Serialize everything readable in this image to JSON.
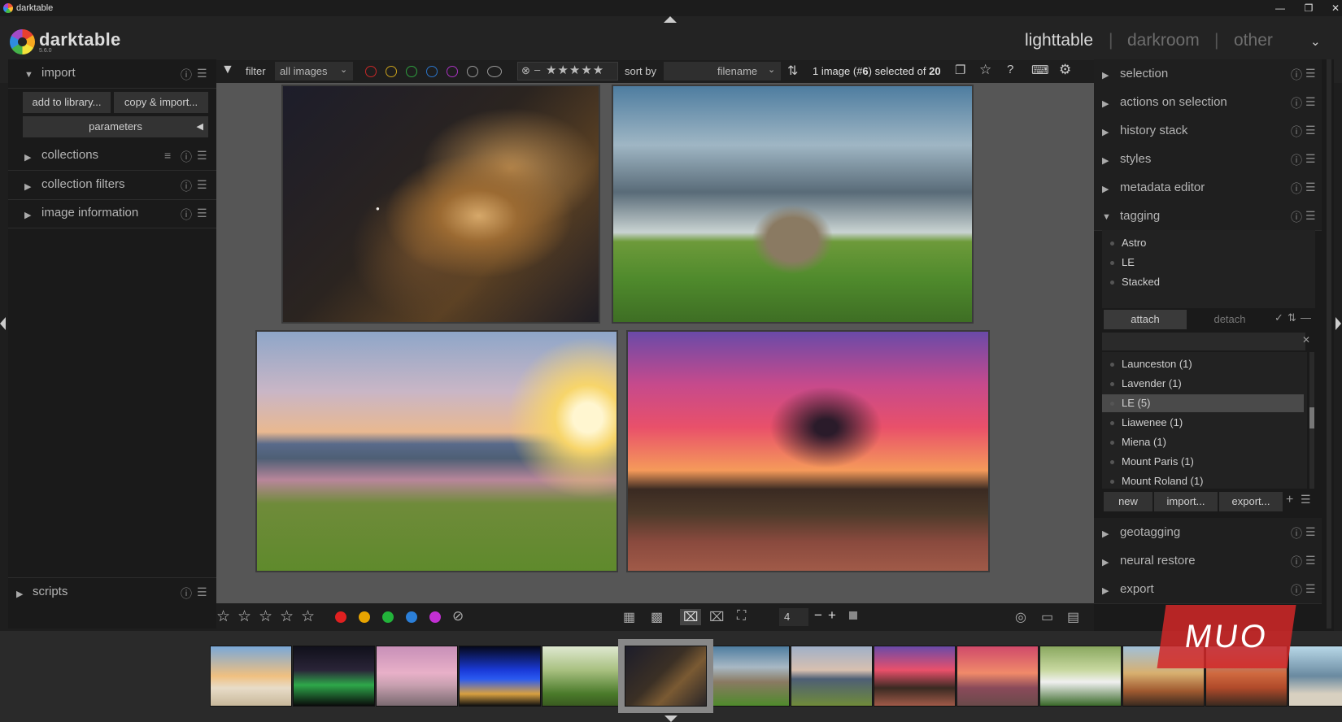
{
  "window": {
    "title": "darktable",
    "controls": [
      "minimize-icon",
      "restore-icon",
      "close-icon"
    ]
  },
  "brand": {
    "name": "darktable",
    "version": "5.6.0"
  },
  "views": {
    "lighttable": "lighttable",
    "darkroom": "darkroom",
    "other": "other",
    "sep": "|"
  },
  "left": {
    "import": {
      "label": "import",
      "add_btn": "add to library...",
      "copy_btn": "copy & import...",
      "params_btn": "parameters"
    },
    "sections": [
      "collections",
      "collection filters",
      "image information"
    ],
    "scripts": "scripts"
  },
  "filterbar": {
    "filter_label": "filter",
    "filter_value": "all images",
    "sort_label": "sort by",
    "sort_value": "filename",
    "selection_info_prefix": "1 image (#",
    "selection_info_num": "6",
    "selection_info_mid": ") selected of ",
    "selection_info_total": "20",
    "rating_stars": 5,
    "color_labels": [
      "#c62828",
      "#c9a11c",
      "#2e9e3e",
      "#2b74c8",
      "#a832c0"
    ]
  },
  "bottombar": {
    "rating_stars": 5,
    "color_labels": [
      "#e02020",
      "#e8a400",
      "#22b33a",
      "#2b7fd8",
      "#c22fd3"
    ],
    "zoom_value": "4",
    "minus": "−",
    "plus": "+"
  },
  "right": {
    "sections_top": [
      "selection",
      "actions on selection",
      "history stack",
      "styles",
      "metadata editor"
    ],
    "tagging": {
      "label": "tagging",
      "attached": [
        "Astro",
        "LE",
        "Stacked"
      ],
      "attach_btn": "attach",
      "detach_btn": "detach",
      "dictionary": [
        "Launceston (1)",
        "Lavender (1)",
        "LE (5)",
        "Liawenee (1)",
        "Miena (1)",
        "Mount Paris (1)",
        "Mount Roland (1)"
      ],
      "selected_index": 2,
      "new_btn": "new",
      "import_btn": "import...",
      "export_btn": "export..."
    },
    "sections_bottom": [
      "geotagging",
      "neural restore",
      "export"
    ]
  },
  "colors": {
    "accent": "#4a4a4a",
    "bg": "#1e1e1e",
    "selected_thumb": "#888888"
  },
  "watermark": "MUO"
}
